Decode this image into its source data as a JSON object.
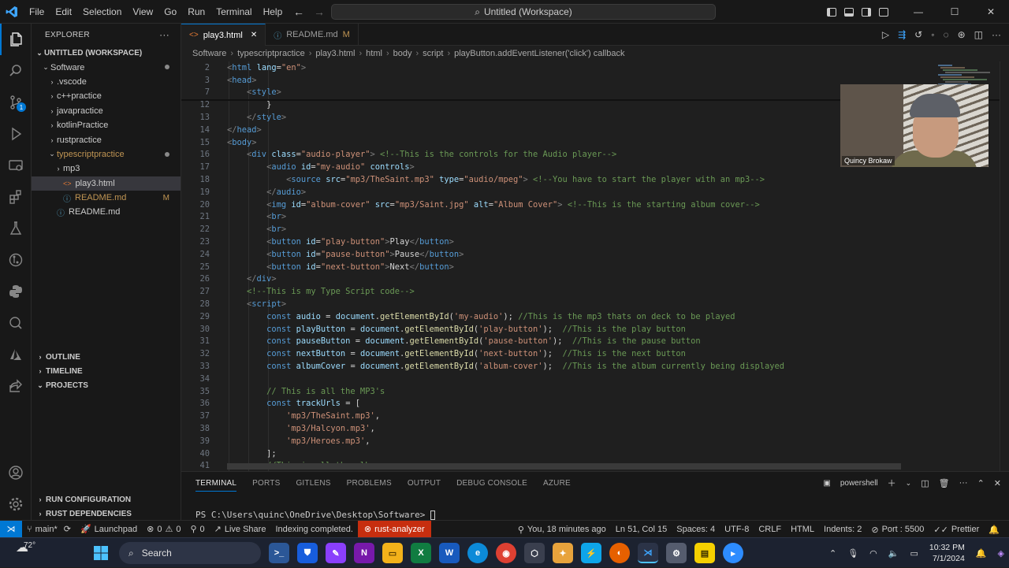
{
  "titlebar": {
    "menu": [
      "File",
      "Edit",
      "Selection",
      "View",
      "Go",
      "Run",
      "Terminal",
      "Help"
    ],
    "command_center": "Untitled (Workspace)",
    "minimize": "—",
    "maximize": "☐",
    "close": "✕"
  },
  "explorer": {
    "title": "EXPLORER",
    "more": "···",
    "workspace": "UNTITLED (WORKSPACE)",
    "items": [
      {
        "label": "Software",
        "indent": 1,
        "kind": "folder-open",
        "decoration": "dot"
      },
      {
        "label": ".vscode",
        "indent": 2,
        "kind": "folder"
      },
      {
        "label": "c++practice",
        "indent": 2,
        "kind": "folder"
      },
      {
        "label": "javapractice",
        "indent": 2,
        "kind": "folder"
      },
      {
        "label": "kotlinPractice",
        "indent": 2,
        "kind": "folder"
      },
      {
        "label": "rustpractice",
        "indent": 2,
        "kind": "folder"
      },
      {
        "label": "typescriptpractice",
        "indent": 2,
        "kind": "folder-open",
        "decoration": "dot",
        "accent": true
      },
      {
        "label": "mp3",
        "indent": 3,
        "kind": "folder"
      },
      {
        "label": "play3.html",
        "indent": 3,
        "kind": "html",
        "selected": true
      },
      {
        "label": "README.md",
        "indent": 3,
        "kind": "md",
        "decoration": "M",
        "accent": true
      },
      {
        "label": "README.md",
        "indent": 2,
        "kind": "md"
      }
    ],
    "sections": [
      "OUTLINE",
      "TIMELINE",
      "PROJECTS"
    ],
    "bottom_sections": [
      "RUN CONFIGURATION",
      "RUST DEPENDENCIES"
    ]
  },
  "tabs": [
    {
      "label": "play3.html",
      "icon": "html-icon",
      "active": true,
      "close": "✕"
    },
    {
      "label": "README.md",
      "icon": "info-icon",
      "active": false,
      "modified": "M"
    }
  ],
  "breadcrumb": [
    "Software",
    "typescriptpractice",
    "play3.html",
    "html",
    "body",
    "script",
    "playButton.addEventListener('click') callback"
  ],
  "editor": {
    "lines": [
      {
        "n": "2",
        "i": 0,
        "t": [
          [
            "br",
            "<"
          ],
          [
            "tag",
            "html"
          ],
          [
            "plain",
            " "
          ],
          [
            "attr",
            "lang"
          ],
          [
            "plain",
            "="
          ],
          [
            "str",
            "\"en\""
          ],
          [
            "br",
            ">"
          ]
        ]
      },
      {
        "n": "3",
        "i": 0,
        "t": [
          [
            "br",
            "<"
          ],
          [
            "tag",
            "head"
          ],
          [
            "br",
            ">"
          ]
        ]
      },
      {
        "n": "7",
        "i": 1,
        "t": [
          [
            "br",
            "<"
          ],
          [
            "tag",
            "style"
          ],
          [
            "br",
            ">"
          ]
        ]
      },
      {
        "n": "12",
        "i": 2,
        "t": [
          [
            "plain",
            "}"
          ]
        ]
      },
      {
        "n": "13",
        "i": 1,
        "t": [
          [
            "br",
            "</"
          ],
          [
            "tag",
            "style"
          ],
          [
            "br",
            ">"
          ]
        ]
      },
      {
        "n": "14",
        "i": 0,
        "t": [
          [
            "br",
            "</"
          ],
          [
            "tag",
            "head"
          ],
          [
            "br",
            ">"
          ]
        ]
      },
      {
        "n": "15",
        "i": 0,
        "t": [
          [
            "br",
            "<"
          ],
          [
            "tag",
            "body"
          ],
          [
            "br",
            ">"
          ]
        ]
      },
      {
        "n": "16",
        "i": 1,
        "t": [
          [
            "br",
            "<"
          ],
          [
            "tag",
            "div"
          ],
          [
            "plain",
            " "
          ],
          [
            "attr",
            "class"
          ],
          [
            "plain",
            "="
          ],
          [
            "str",
            "\"audio-player\""
          ],
          [
            "br",
            ">"
          ],
          [
            "plain",
            " "
          ],
          [
            "com",
            "<!--This is the controls for the Audio player-->"
          ]
        ]
      },
      {
        "n": "17",
        "i": 2,
        "t": [
          [
            "br",
            "<"
          ],
          [
            "tag",
            "audio"
          ],
          [
            "plain",
            " "
          ],
          [
            "attr",
            "id"
          ],
          [
            "plain",
            "="
          ],
          [
            "str",
            "\"my-audio\""
          ],
          [
            "plain",
            " "
          ],
          [
            "attr",
            "controls"
          ],
          [
            "br",
            ">"
          ]
        ]
      },
      {
        "n": "18",
        "i": 3,
        "t": [
          [
            "br",
            "<"
          ],
          [
            "tag",
            "source"
          ],
          [
            "plain",
            " "
          ],
          [
            "attr",
            "src"
          ],
          [
            "plain",
            "="
          ],
          [
            "str",
            "\"mp3/TheSaint.mp3\""
          ],
          [
            "plain",
            " "
          ],
          [
            "attr",
            "type"
          ],
          [
            "plain",
            "="
          ],
          [
            "str",
            "\"audio/mpeg\""
          ],
          [
            "br",
            ">"
          ],
          [
            "plain",
            " "
          ],
          [
            "com",
            "<!--You have to start the player with an mp3-->"
          ]
        ]
      },
      {
        "n": "19",
        "i": 2,
        "t": [
          [
            "br",
            "</"
          ],
          [
            "tag",
            "audio"
          ],
          [
            "br",
            ">"
          ]
        ]
      },
      {
        "n": "20",
        "i": 2,
        "t": [
          [
            "br",
            "<"
          ],
          [
            "tag",
            "img"
          ],
          [
            "plain",
            " "
          ],
          [
            "attr",
            "id"
          ],
          [
            "plain",
            "="
          ],
          [
            "str",
            "\"album-cover\""
          ],
          [
            "plain",
            " "
          ],
          [
            "attr",
            "src"
          ],
          [
            "plain",
            "="
          ],
          [
            "str",
            "\"mp3/Saint.jpg\""
          ],
          [
            "plain",
            " "
          ],
          [
            "attr",
            "alt"
          ],
          [
            "plain",
            "="
          ],
          [
            "str",
            "\"Album Cover\""
          ],
          [
            "br",
            ">"
          ],
          [
            "plain",
            " "
          ],
          [
            "com",
            "<!--This is the starting album cover-->"
          ]
        ]
      },
      {
        "n": "21",
        "i": 2,
        "t": [
          [
            "br",
            "<"
          ],
          [
            "tag",
            "br"
          ],
          [
            "br",
            ">"
          ]
        ]
      },
      {
        "n": "22",
        "i": 2,
        "t": [
          [
            "br",
            "<"
          ],
          [
            "tag",
            "br"
          ],
          [
            "br",
            ">"
          ]
        ]
      },
      {
        "n": "23",
        "i": 2,
        "t": [
          [
            "br",
            "<"
          ],
          [
            "tag",
            "button"
          ],
          [
            "plain",
            " "
          ],
          [
            "attr",
            "id"
          ],
          [
            "plain",
            "="
          ],
          [
            "str",
            "\"play-button\""
          ],
          [
            "br",
            ">"
          ],
          [
            "plain",
            "Play"
          ],
          [
            "br",
            "</"
          ],
          [
            "tag",
            "button"
          ],
          [
            "br",
            ">"
          ]
        ]
      },
      {
        "n": "24",
        "i": 2,
        "t": [
          [
            "br",
            "<"
          ],
          [
            "tag",
            "button"
          ],
          [
            "plain",
            " "
          ],
          [
            "attr",
            "id"
          ],
          [
            "plain",
            "="
          ],
          [
            "str",
            "\"pause-button\""
          ],
          [
            "br",
            ">"
          ],
          [
            "plain",
            "Pause"
          ],
          [
            "br",
            "</"
          ],
          [
            "tag",
            "button"
          ],
          [
            "br",
            ">"
          ]
        ]
      },
      {
        "n": "25",
        "i": 2,
        "t": [
          [
            "br",
            "<"
          ],
          [
            "tag",
            "button"
          ],
          [
            "plain",
            " "
          ],
          [
            "attr",
            "id"
          ],
          [
            "plain",
            "="
          ],
          [
            "str",
            "\"next-button\""
          ],
          [
            "br",
            ">"
          ],
          [
            "plain",
            "Next"
          ],
          [
            "br",
            "</"
          ],
          [
            "tag",
            "button"
          ],
          [
            "br",
            ">"
          ]
        ]
      },
      {
        "n": "26",
        "i": 1,
        "t": [
          [
            "br",
            "</"
          ],
          [
            "tag",
            "div"
          ],
          [
            "br",
            ">"
          ]
        ]
      },
      {
        "n": "27",
        "i": 1,
        "t": [
          [
            "com",
            "<!--This is my Type Script code-->"
          ]
        ]
      },
      {
        "n": "28",
        "i": 1,
        "t": [
          [
            "br",
            "<"
          ],
          [
            "tag",
            "script"
          ],
          [
            "br",
            ">"
          ]
        ]
      },
      {
        "n": "29",
        "i": 2,
        "t": [
          [
            "kw",
            "const"
          ],
          [
            "plain",
            " "
          ],
          [
            "var",
            "audio"
          ],
          [
            "plain",
            " = "
          ],
          [
            "var",
            "document"
          ],
          [
            "plain",
            "."
          ],
          [
            "fn",
            "getElementById"
          ],
          [
            "plain",
            "("
          ],
          [
            "str",
            "'my-audio'"
          ],
          [
            "plain",
            ");"
          ],
          [
            "plain",
            " "
          ],
          [
            "com",
            "//This is the mp3 thats on deck to be played"
          ]
        ]
      },
      {
        "n": "30",
        "i": 2,
        "t": [
          [
            "kw",
            "const"
          ],
          [
            "plain",
            " "
          ],
          [
            "var",
            "playButton"
          ],
          [
            "plain",
            " = "
          ],
          [
            "var",
            "document"
          ],
          [
            "plain",
            "."
          ],
          [
            "fn",
            "getElementById"
          ],
          [
            "plain",
            "("
          ],
          [
            "str",
            "'play-button'"
          ],
          [
            "plain",
            ");"
          ],
          [
            "plain",
            "  "
          ],
          [
            "com",
            "//This is the play button"
          ]
        ]
      },
      {
        "n": "31",
        "i": 2,
        "t": [
          [
            "kw",
            "const"
          ],
          [
            "plain",
            " "
          ],
          [
            "var",
            "pauseButton"
          ],
          [
            "plain",
            " = "
          ],
          [
            "var",
            "document"
          ],
          [
            "plain",
            "."
          ],
          [
            "fn",
            "getElementById"
          ],
          [
            "plain",
            "("
          ],
          [
            "str",
            "'pause-button'"
          ],
          [
            "plain",
            ");"
          ],
          [
            "plain",
            "  "
          ],
          [
            "com",
            "//This is the pause button"
          ]
        ]
      },
      {
        "n": "32",
        "i": 2,
        "t": [
          [
            "kw",
            "const"
          ],
          [
            "plain",
            " "
          ],
          [
            "var",
            "nextButton"
          ],
          [
            "plain",
            " = "
          ],
          [
            "var",
            "document"
          ],
          [
            "plain",
            "."
          ],
          [
            "fn",
            "getElementById"
          ],
          [
            "plain",
            "("
          ],
          [
            "str",
            "'next-button'"
          ],
          [
            "plain",
            ");"
          ],
          [
            "plain",
            "  "
          ],
          [
            "com",
            "//This is the next button"
          ]
        ]
      },
      {
        "n": "33",
        "i": 2,
        "t": [
          [
            "kw",
            "const"
          ],
          [
            "plain",
            " "
          ],
          [
            "var",
            "albumCover"
          ],
          [
            "plain",
            " = "
          ],
          [
            "var",
            "document"
          ],
          [
            "plain",
            "."
          ],
          [
            "fn",
            "getElementById"
          ],
          [
            "plain",
            "("
          ],
          [
            "str",
            "'album-cover'"
          ],
          [
            "plain",
            ");"
          ],
          [
            "plain",
            "  "
          ],
          [
            "com",
            "//This is the album currently being displayed"
          ]
        ]
      },
      {
        "n": "34",
        "i": 0,
        "t": []
      },
      {
        "n": "35",
        "i": 2,
        "t": [
          [
            "com",
            "// This is all the MP3's"
          ]
        ]
      },
      {
        "n": "36",
        "i": 2,
        "t": [
          [
            "kw",
            "const"
          ],
          [
            "plain",
            " "
          ],
          [
            "var",
            "trackUrls"
          ],
          [
            "plain",
            " = ["
          ]
        ]
      },
      {
        "n": "37",
        "i": 3,
        "t": [
          [
            "str",
            "'mp3/TheSaint.mp3'"
          ],
          [
            "plain",
            ","
          ]
        ]
      },
      {
        "n": "38",
        "i": 3,
        "t": [
          [
            "str",
            "'mp3/Halcyon.mp3'"
          ],
          [
            "plain",
            ","
          ]
        ]
      },
      {
        "n": "39",
        "i": 3,
        "t": [
          [
            "str",
            "'mp3/Heroes.mp3'"
          ],
          [
            "plain",
            ","
          ]
        ]
      },
      {
        "n": "40",
        "i": 2,
        "t": [
          [
            "plain",
            "];"
          ]
        ]
      },
      {
        "n": "41",
        "i": 2,
        "t": [
          [
            "com",
            "//This is all the album covers"
          ]
        ]
      }
    ]
  },
  "webcam": {
    "name": "Quincy Brokaw"
  },
  "panel": {
    "tabs": [
      "TERMINAL",
      "PORTS",
      "GITLENS",
      "PROBLEMS",
      "OUTPUT",
      "DEBUG CONSOLE",
      "AZURE"
    ],
    "shell": "powershell",
    "prompt": "PS C:\\Users\\quinc\\OneDrive\\Desktop\\Software> "
  },
  "statusbar": {
    "branch": "main*",
    "launchpad": "Launchpad",
    "errors": "0",
    "warnings": "0",
    "info": "0",
    "live_share": "Live Share",
    "indexing": "Indexing completed.",
    "rust_analyzer": "rust-analyzer",
    "blame": "You, 18 minutes ago",
    "position": "Ln 51, Col 15",
    "spaces": "Spaces: 4",
    "encoding": "UTF-8",
    "eol": "CRLF",
    "language": "HTML",
    "indents": "Indents: 2",
    "port": "Port : 5500",
    "prettier": "Prettier"
  },
  "taskbar": {
    "temp": "72°",
    "search": "Search",
    "time": "10:32 PM",
    "date": "7/1/2024"
  },
  "colors": {
    "accent": "#0078d4",
    "error_bg": "#c72e0f",
    "editor_bg": "#1f1f1f"
  }
}
